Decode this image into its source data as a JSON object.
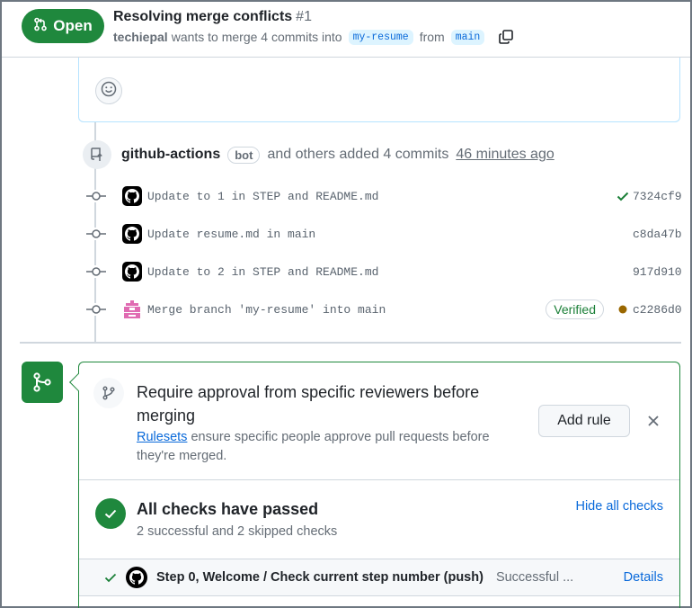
{
  "header": {
    "state": "Open",
    "title": "Resolving merge conflicts",
    "number": "#1",
    "author": "techiepal",
    "meta_text": "wants to merge 4 commits into",
    "base_branch": "my-resume",
    "from_text": "from",
    "head_branch": "main"
  },
  "commits_group": {
    "actor": "github-actions",
    "bot_label": "bot",
    "summary": "and others added 4 commits",
    "time": "46 minutes ago",
    "commits": [
      {
        "message": "Update to 1 in STEP and README.md",
        "sha": "7324cf9",
        "status": "success",
        "avatar": "github-icon"
      },
      {
        "message": "Update resume.md in main",
        "sha": "c8da47b",
        "status": "",
        "avatar": "github-icon"
      },
      {
        "message": "Update to 2 in STEP and README.md",
        "sha": "917d910",
        "status": "",
        "avatar": "github-icon"
      },
      {
        "message": "Merge branch 'my-resume' into main",
        "sha": "c2286d0",
        "status": "pending",
        "avatar": "user-avatar",
        "verified": "Verified"
      }
    ]
  },
  "merge_box": {
    "rule": {
      "title": "Require approval from specific reviewers before merging",
      "link_text": "Rulesets",
      "description": "ensure specific people approve pull requests before they're merged.",
      "add_rule_label": "Add rule"
    },
    "checks": {
      "title": "All checks have passed",
      "subtitle": "2 successful and 2 skipped checks",
      "hide_label": "Hide all checks",
      "items": [
        {
          "name": "Step 0, Welcome / Check current step number (push)",
          "status": "Successful ...",
          "details": "Details"
        }
      ]
    }
  },
  "colors": {
    "green": "#1f883d",
    "blue": "#0969da",
    "pending": "#9a6700"
  }
}
